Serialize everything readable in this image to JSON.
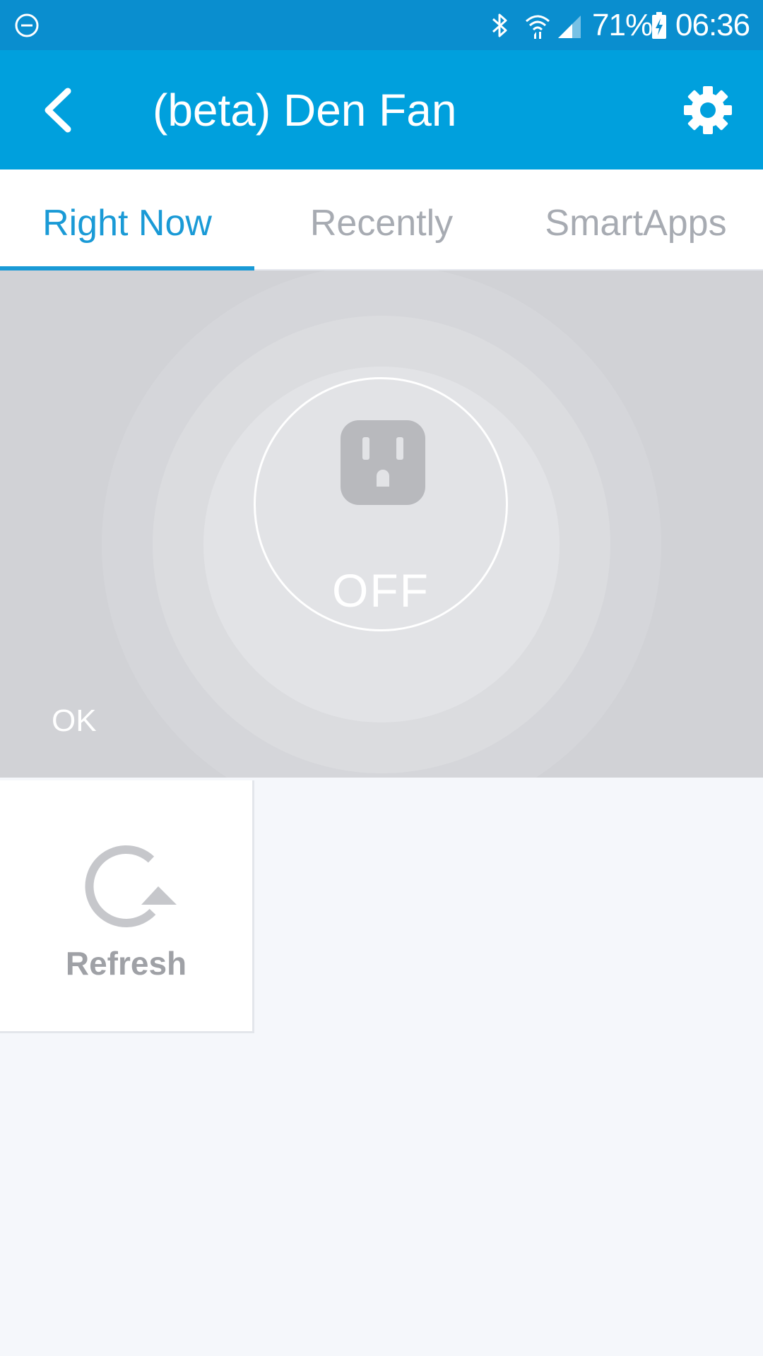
{
  "status_bar": {
    "battery_percent": "71%",
    "time": "06:36"
  },
  "app_bar": {
    "title": "(beta) Den Fan",
    "back_icon": "chevron-left-icon",
    "settings_icon": "gear-icon"
  },
  "tabs": [
    {
      "label": "Right Now",
      "active": true
    },
    {
      "label": "Recently",
      "active": false
    },
    {
      "label": "SmartApps",
      "active": false
    }
  ],
  "device": {
    "icon": "outlet-icon",
    "state": "OFF",
    "status": "OK"
  },
  "refresh": {
    "icon": "refresh-icon",
    "label": "Refresh"
  },
  "colors": {
    "status_bar": "#0a8ecf",
    "app_bar": "#00a0dd",
    "accent": "#1a9ad6",
    "inactive_tab": "#a7abb2",
    "device_tile": "#d1d2d6",
    "background": "#f5f7fb"
  }
}
